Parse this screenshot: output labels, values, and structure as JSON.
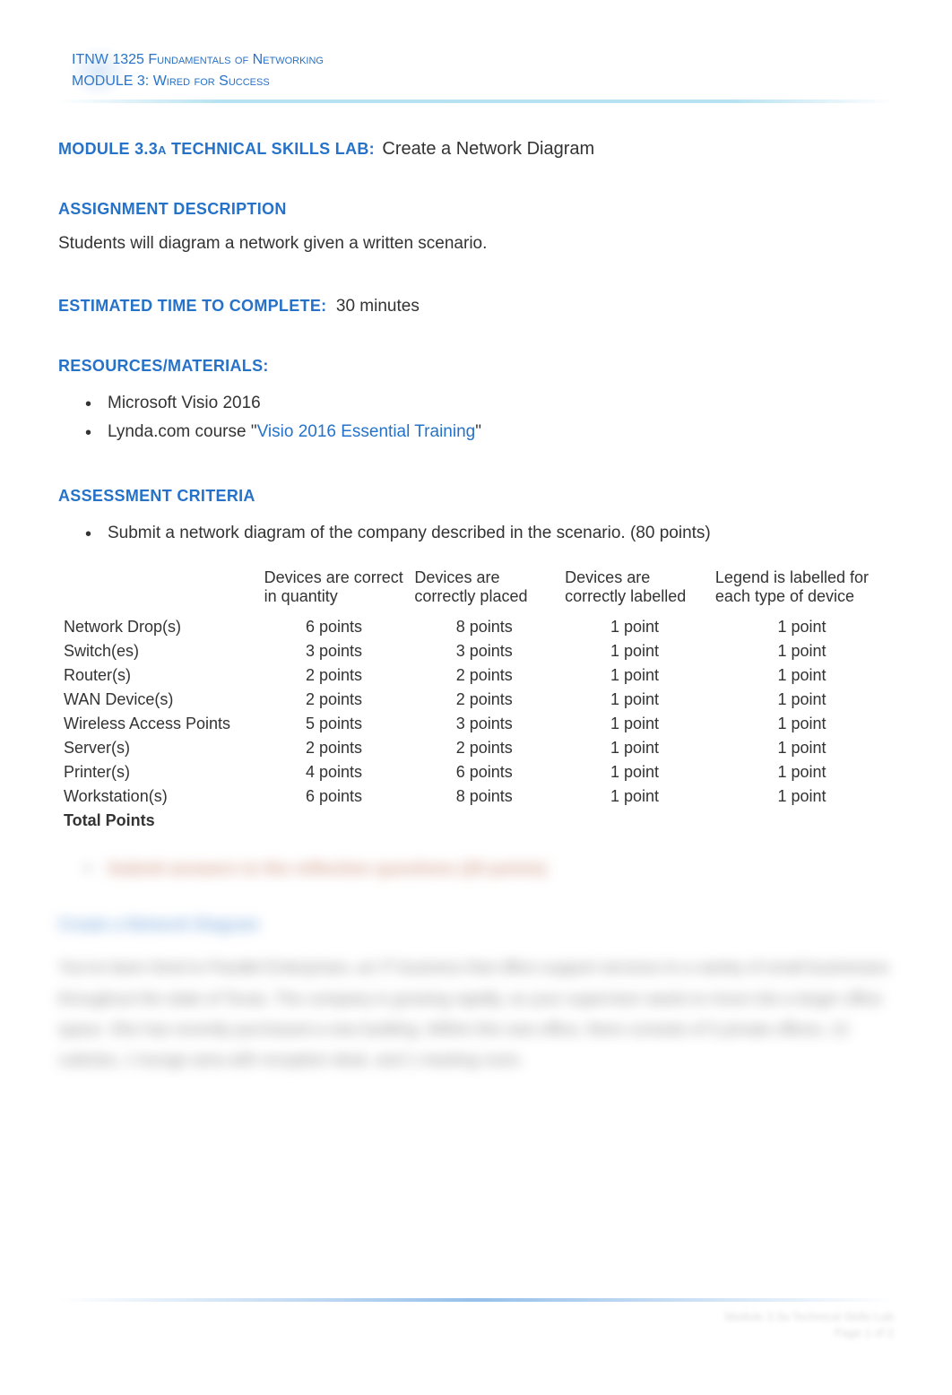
{
  "header": {
    "line1": "ITNW 1325 Fundamentals of Networking",
    "line2": "MODULE 3: Wired for Success"
  },
  "title": {
    "label": "MODULE 3.3a TECHNICAL SKILLS LAB:",
    "text": "Create a Network Diagram"
  },
  "assignment": {
    "label": "ASSIGNMENT DESCRIPTION",
    "text": "Students will diagram a network given a written scenario."
  },
  "estimated": {
    "label": "ESTIMATED TIME TO COMPLETE:",
    "text": "30 minutes"
  },
  "resources": {
    "label": "RESOURCES/MATERIALS:",
    "items": [
      {
        "pre": "Microsoft Visio 2016",
        "link": "",
        "post": ""
      },
      {
        "pre": "Lynda.com course \"",
        "link": "Visio 2016 Essential Training",
        "post": "\""
      }
    ]
  },
  "assessment": {
    "label": "ASSESSMENT CRITERIA",
    "bullet": "Submit a network diagram of the company described in the scenario. (80 points)"
  },
  "rubric": {
    "headers": [
      "",
      "Devices are correct in quantity",
      "Devices are correctly placed",
      "Devices are correctly labelled",
      "Legend is labelled for each type of device"
    ],
    "rows": [
      {
        "name": "Network Drop(s)",
        "c1": "6 points",
        "c2": "8 points",
        "c3": "1 point",
        "c4": "1 point"
      },
      {
        "name": "Switch(es)",
        "c1": "3 points",
        "c2": "3 points",
        "c3": "1 point",
        "c4": "1 point"
      },
      {
        "name": "Router(s)",
        "c1": "2 points",
        "c2": "2 points",
        "c3": "1 point",
        "c4": "1 point"
      },
      {
        "name": "WAN Device(s)",
        "c1": "2 points",
        "c2": "2 points",
        "c3": "1 point",
        "c4": "1 point"
      },
      {
        "name": "Wireless Access Points",
        "c1": "5 points",
        "c2": "3 points",
        "c3": "1 point",
        "c4": "1 point"
      },
      {
        "name": "Server(s)",
        "c1": "2 points",
        "c2": "2 points",
        "c3": "1 point",
        "c4": "1 point"
      },
      {
        "name": "Printer(s)",
        "c1": "4 points",
        "c2": "6 points",
        "c3": "1 point",
        "c4": "1 point"
      },
      {
        "name": "Workstation(s)",
        "c1": "6 points",
        "c2": "8 points",
        "c3": "1 point",
        "c4": "1 point"
      }
    ],
    "total_label": "Total Points"
  },
  "blurred": {
    "bullet": "Submit answers to the reflection questions (20 points)",
    "heading": "Create a Network Diagram",
    "para": "You've been hired to Parallel Enterprises, an IT business that offers support services to a variety of small businesses throughout the state of Texas. The company is growing rapidly, so your supervisor wants to move into a larger office space. She has recently purchased a new building. Within this new office, there consists of 5 private offices, 12 cubicles, 1 lounge area with reception desk, and 1 meeting room."
  },
  "footer": {
    "line1": "Module 3.3a Technical Skills Lab",
    "line2": "Page 1 of 2"
  }
}
